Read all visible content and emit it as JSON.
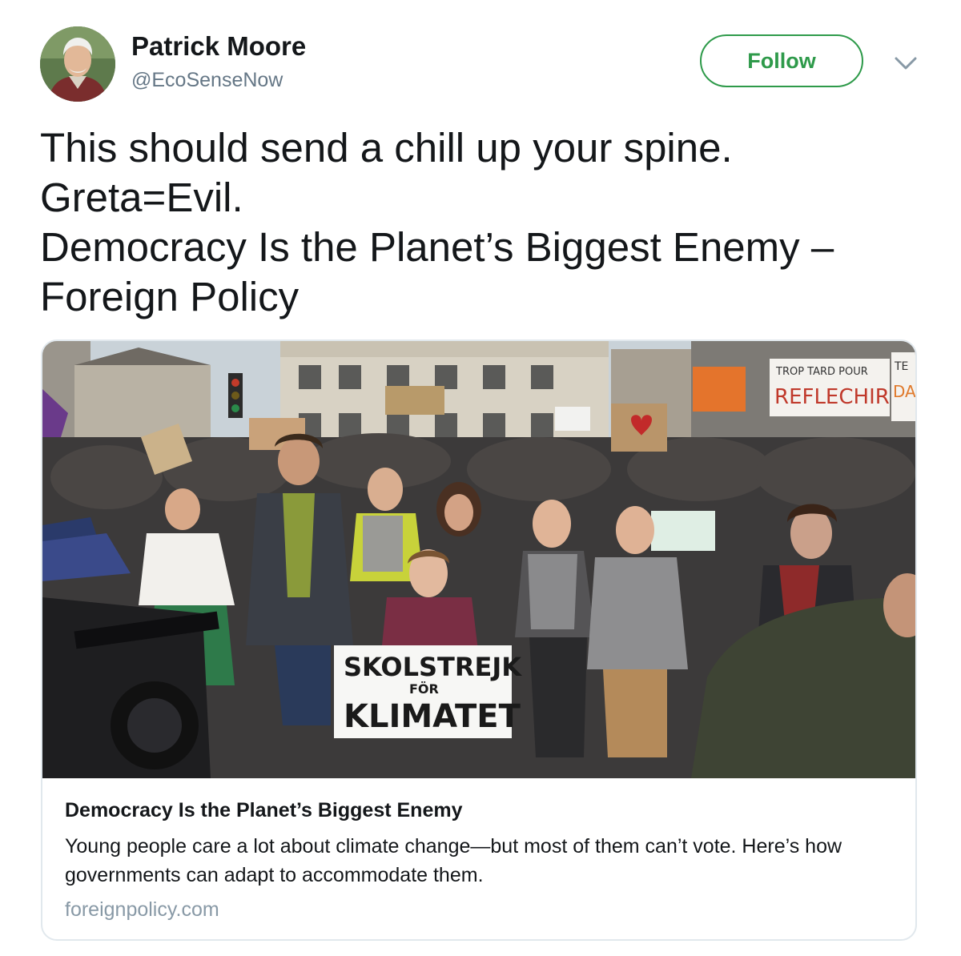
{
  "author": {
    "name": "Patrick Moore",
    "handle": "@EcoSenseNow"
  },
  "follow_button": {
    "label": "Follow"
  },
  "tweet": {
    "lines": [
      "This should send a chill up your spine.",
      "Greta=Evil.",
      "Democracy Is the Planet’s Biggest Enemy –",
      "Foreign Policy"
    ]
  },
  "card": {
    "title": "Democracy Is the Planet’s Biggest Enemy",
    "description": "Young people care a lot about climate change—but most of them can’t vote. Here’s how governments can adapt to accommodate them.",
    "domain": "foreignpolicy.com",
    "image": {
      "sign_line1": "SKOLSTREJK",
      "sign_line2": "FÖR",
      "sign_line3": "KLIMATET",
      "banner_top_right_1": "TROP TARD POUR",
      "banner_top_right_2": "REFLECHIR",
      "banner_top_right_3": "TE",
      "banner_top_right_4": "DA"
    }
  },
  "colors": {
    "accent": "#2e9a4a",
    "secondary_text": "#657786",
    "border": "#e1e8ed"
  },
  "icons": {
    "menu": "chevron-down-icon"
  }
}
